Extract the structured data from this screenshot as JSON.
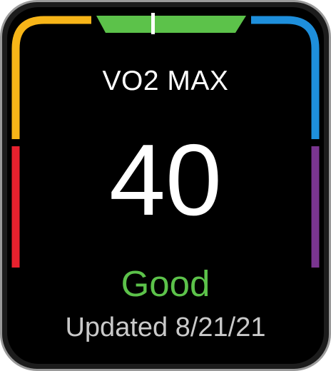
{
  "metric": {
    "title": "VO2 MAX",
    "value": "40",
    "rating": "Good",
    "updated": "Updated 8/21/21"
  },
  "gauge": {
    "segments": [
      {
        "name": "gauge-segment-red",
        "color": "#e8212e"
      },
      {
        "name": "gauge-segment-orange",
        "color": "#f7b518"
      },
      {
        "name": "gauge-segment-green",
        "color": "#5cc24a"
      },
      {
        "name": "gauge-segment-blue",
        "color": "#1e8fdc"
      },
      {
        "name": "gauge-segment-purple",
        "color": "#7a3590"
      }
    ],
    "indicator_color": "#ffffff"
  },
  "colors": {
    "background": "#000000",
    "rating": "#5cc24a",
    "updated_text": "#c9c9c9"
  }
}
